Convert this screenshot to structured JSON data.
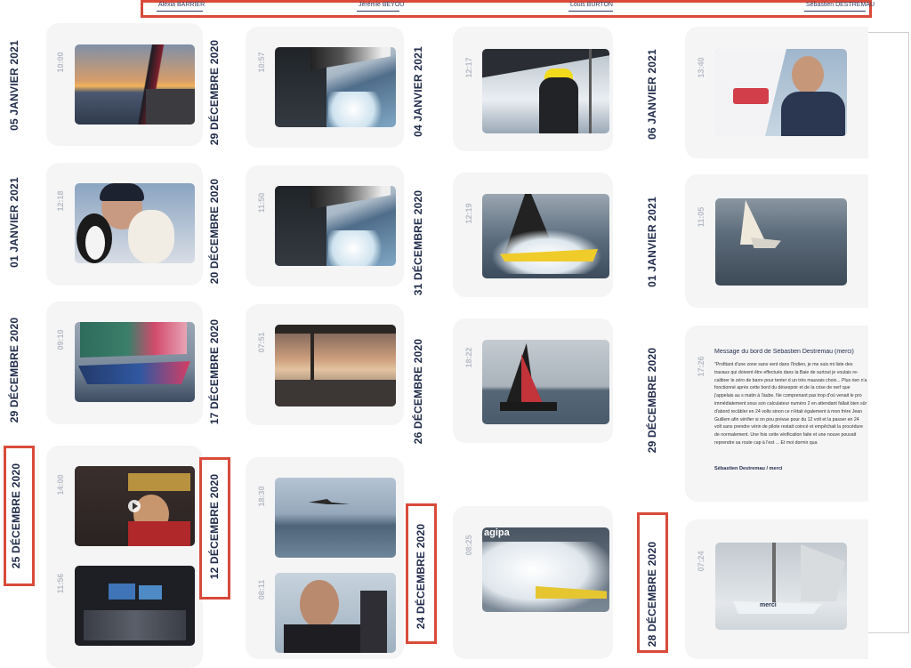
{
  "sailors": [
    "Alexia BARRIER",
    "Jérémie BEYOU",
    "Louis BURTON",
    "Sébastien DESTREMAU"
  ],
  "columns": [
    {
      "name": "alexia-barrier",
      "dates": [
        "05 JANVIER 2021",
        "01 JANVIER 2021",
        "29 DÉCEMBRE 2020",
        "25 DÉCEMBRE 2020"
      ],
      "highlight": "25 DÉCEMBRE 2020",
      "times": [
        "10:00",
        "12:18",
        "09:10",
        "14:00",
        "11:56"
      ]
    },
    {
      "name": "jeremie-beyou",
      "dates": [
        "29 DÉCEMBRE 2020",
        "20 DÉCEMBRE 2020",
        "17 DÉCEMBRE 2020",
        "12 DÉCEMBRE 2020"
      ],
      "highlight": "12 DÉCEMBRE 2020",
      "times": [
        "10:57",
        "11:50",
        "07:51",
        "18:30",
        "08:11"
      ]
    },
    {
      "name": "louis-burton",
      "dates": [
        "04 JANVIER 2021",
        "31 DÉCEMBRE 2020",
        "26 DÉCEMBRE 2020",
        "24 DÉCEMBRE 2020"
      ],
      "highlight": "24 DÉCEMBRE 2020",
      "times": [
        "12:17",
        "12:19",
        "18:22",
        "08:25"
      ]
    },
    {
      "name": "sebastien-destremau",
      "dates": [
        "06 JANVIER 2021",
        "01 JANVIER 2021",
        "29 DÉCEMBRE 2020",
        "28 DÉCEMBRE 2020"
      ],
      "highlight": "28 DÉCEMBRE 2020",
      "times": [
        "13:40",
        "11:05",
        "17:26",
        "07:24"
      ]
    }
  ],
  "message": {
    "title": "Message du bord de Sébastien Destremau (merci)",
    "body": "\"Profitant d'une zone sans vent dans l'Indien, je me suis mi liste des travaux qui doivent être effectués dans la Baie de surtout je voulais re-calibrer le zéro de barre pour tenter d un très mauvais choix... Plus rien n'a fonctionné après cette bord du désespoir et de la crise de nerf que j'appelais au s matin à l'aube. Ne comprenant pas trop d'où venait le pro immédiatement sous son calculateur numéro 2 en attendant fallait bien sûr d'abord recâbler en 24 volts sinon ce n'était également à mon frère Jean Guillem afin vérifier si on pou prévue pour du 12 volt et la passer en 24 volt sans prendre vérin de pilote restait coincé et empêchait la procédure de normalement. Une fois cette vérification faite et une nouve pouvait reprendre sa route cap à l'est ... Et moi dormir qua",
    "signature": "Sébastien Destremau / merci"
  },
  "thumb_overlays": {
    "boat_sail_lettering": "agipa",
    "hull_lettering": "merci"
  },
  "colors": {
    "highlight_red": "#d94a3a",
    "date_navy": "#1f2a4a",
    "time_gray": "#b7bcc6",
    "card_bg": "#f5f5f6"
  }
}
